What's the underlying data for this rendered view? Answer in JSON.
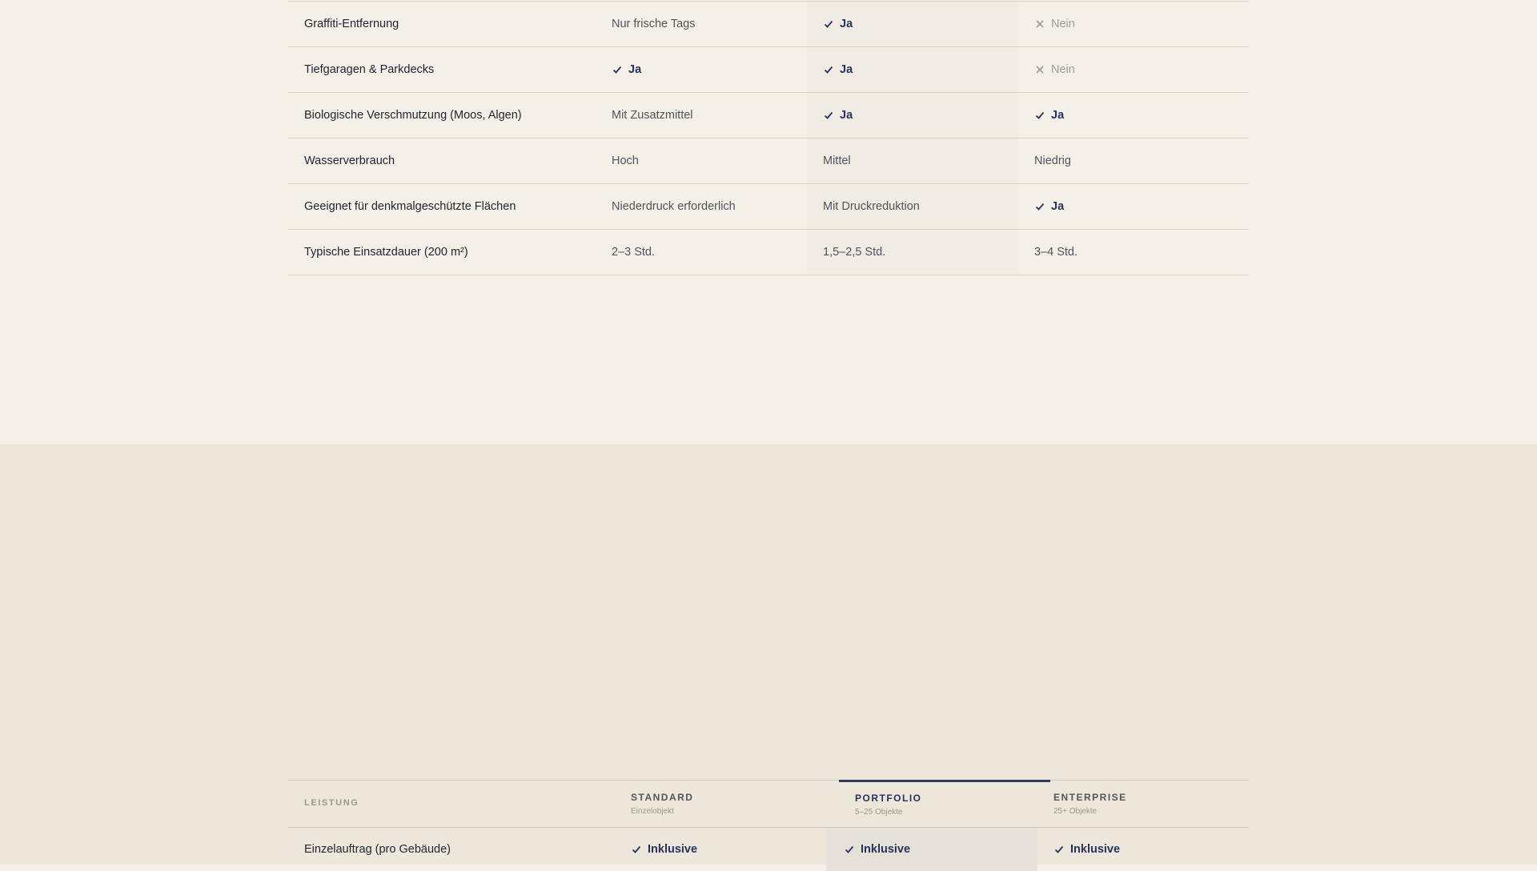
{
  "comparison": {
    "rows": [
      {
        "feature": "Graffiti-Entfernung",
        "values": [
          {
            "type": "plain",
            "text": "Nur frische Tags"
          },
          {
            "type": "yes",
            "text": "Ja"
          },
          {
            "type": "no",
            "text": "Nein"
          }
        ]
      },
      {
        "feature": "Tiefgaragen & Parkdecks",
        "values": [
          {
            "type": "yes",
            "text": "Ja"
          },
          {
            "type": "yes",
            "text": "Ja"
          },
          {
            "type": "no",
            "text": "Nein"
          }
        ]
      },
      {
        "feature": "Biologische Verschmutzung (Moos, Algen)",
        "values": [
          {
            "type": "plain",
            "text": "Mit Zusatzmittel"
          },
          {
            "type": "yes",
            "text": "Ja"
          },
          {
            "type": "yes",
            "text": "Ja"
          }
        ]
      },
      {
        "feature": "Wasserverbrauch",
        "values": [
          {
            "type": "plain",
            "text": "Hoch"
          },
          {
            "type": "plain",
            "text": "Mittel"
          },
          {
            "type": "plain",
            "text": "Niedrig"
          }
        ]
      },
      {
        "feature": "Geeignet für denkmalgeschützte Flächen",
        "values": [
          {
            "type": "plain",
            "text": "Niederdruck erforderlich"
          },
          {
            "type": "plain",
            "text": "Mit Druckreduktion"
          },
          {
            "type": "yes",
            "text": "Ja"
          }
        ]
      },
      {
        "feature": "Typische Einsatzdauer (200 m²)",
        "values": [
          {
            "type": "plain",
            "text": "2–3 Std."
          },
          {
            "type": "plain",
            "text": "1,5–2,5 Std."
          },
          {
            "type": "plain",
            "text": "3–4 Std."
          }
        ]
      }
    ]
  },
  "plans": {
    "header_label": "LEISTUNG",
    "columns": [
      {
        "name": "STANDARD",
        "sub": "Einzelobjekt"
      },
      {
        "name": "PORTFOLIO",
        "sub": "5–25 Objekte"
      },
      {
        "name": "ENTERPRISE",
        "sub": "25+ Objekte"
      }
    ],
    "rows": [
      {
        "feature": "Einzelauftrag (pro Gebäude)",
        "values": [
          "Inklusive",
          "Inklusive",
          "Inklusive"
        ]
      }
    ]
  },
  "icons": {
    "yes": "check-icon",
    "no": "x-icon"
  },
  "colors": {
    "accent": "#24345f",
    "muted": "#9a9c9f",
    "bg_top": "#f4f0e8",
    "bg_bottom": "#ede6da"
  }
}
